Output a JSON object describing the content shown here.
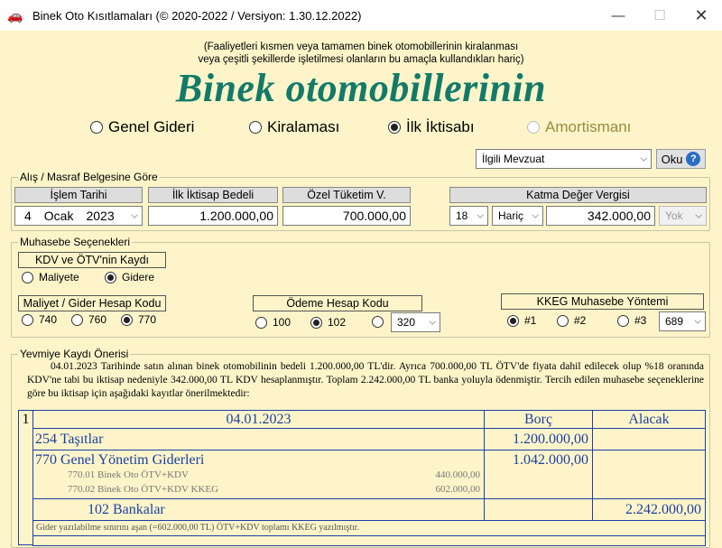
{
  "window": {
    "title": "Binek Oto Kısıtlamaları (© 2020-2022 / Versiyon: 1.30.12.2022)"
  },
  "note_line1": "(Faaliyetleri kısmen veya tamamen binek otomobillerinin kiralanması",
  "note_line2": "veya çeşitli şekillerde işletilmesi olanların bu amaçla kullandıkları hariç)",
  "big_title": "Binek otomobillerinin",
  "modes": [
    {
      "label": "Genel Gideri",
      "selected": false
    },
    {
      "label": "Kiralaması",
      "selected": false
    },
    {
      "label": "İlk İktisabı",
      "selected": true
    },
    {
      "label": "Amortismanı",
      "selected": false,
      "disabled": true
    }
  ],
  "mevzuat": {
    "selected": "İlgili Mevzuat",
    "oku_label": "Oku",
    "help": "?"
  },
  "alis": {
    "group_label": "Alış / Masraf Belgesine Göre",
    "islem_tarihi_label": "İşlem Tarihi",
    "date_day": "4",
    "date_month": "Ocak",
    "date_year": "2023",
    "ilk_iktisap_label": "İlk İktisap Bedeli",
    "ilk_iktisap_value": "1.200.000,00",
    "otv_label": "Özel Tüketim V.",
    "otv_value": "700.000,00",
    "kdv_label": "Katma Değer Vergisi",
    "kdv_rate": "18",
    "kdv_type": "Hariç",
    "kdv_value": "342.000,00",
    "kdv_extra": "Yok"
  },
  "muhasebe": {
    "group_label": "Muhasebe Seçenekleri",
    "kdv_otv_label": "KDV ve ÖTV'nin Kaydı",
    "kdv_otv_options": [
      {
        "label": "Maliyete",
        "selected": false
      },
      {
        "label": "Gidere",
        "selected": true
      }
    ],
    "hesap_kodu_label": "Maliyet / Gider Hesap Kodu",
    "hesap_kodu_options": [
      {
        "label": "740",
        "selected": false
      },
      {
        "label": "760",
        "selected": false
      },
      {
        "label": "770",
        "selected": true
      }
    ],
    "odeme_label": "Ödeme Hesap Kodu",
    "odeme_options": [
      {
        "label": "100",
        "selected": false
      },
      {
        "label": "102",
        "selected": true
      },
      {
        "label": "",
        "selected": false
      }
    ],
    "odeme_select": "320",
    "kkeg_label": "KKEG Muhasebe Yöntemi",
    "kkeg_options": [
      {
        "label": "#1",
        "selected": true
      },
      {
        "label": "#2",
        "selected": false
      },
      {
        "label": "#3",
        "selected": false
      }
    ],
    "kkeg_select": "689"
  },
  "yevmiye": {
    "group_label": "Yevmiye Kaydı Önerisi",
    "text": "04.01.2023 Tarihinde satın alınan binek otomobilinin bedeli 1.200.000,00 TL'dir. Ayrıca 700.000,00 TL ÖTV'de fiyata dahil edilecek olup %18 oranında KDV'ne tabi bu iktisap nedeniyle 342.000,00 TL KDV hesaplanmıştır. Toplam 2.242.000,00 TL banka yoluyla ödenmiştir. Tercih edilen muhasebe seçeneklerine göre bu iktisap için aşağıdaki kayıtlar önerilmektedir:"
  },
  "ledger": {
    "row_no": "1",
    "date": "04.01.2023",
    "borc_header": "Borç",
    "alacak_header": "Alacak",
    "entry1_account": "254 Taşıtlar",
    "entry1_borc": "1.200.000,00",
    "entry2_account": "770 Genel Yönetim Giderleri",
    "entry2_borc": "1.042.000,00",
    "sub1_label": "770.01 Binek Oto ÖTV+KDV",
    "sub1_value": "440.000,00",
    "sub2_label": "770.02 Binek Oto ÖTV+KDV KKEG",
    "sub2_value": "602.000,00",
    "entry3_account": "102 Bankalar",
    "entry3_alacak": "2.242.000,00",
    "note": "Gider yazılabilme sınırını aşan (=602.000,00 TL) ÖTV+KDV toplamı KKEG yazılmıştır."
  }
}
